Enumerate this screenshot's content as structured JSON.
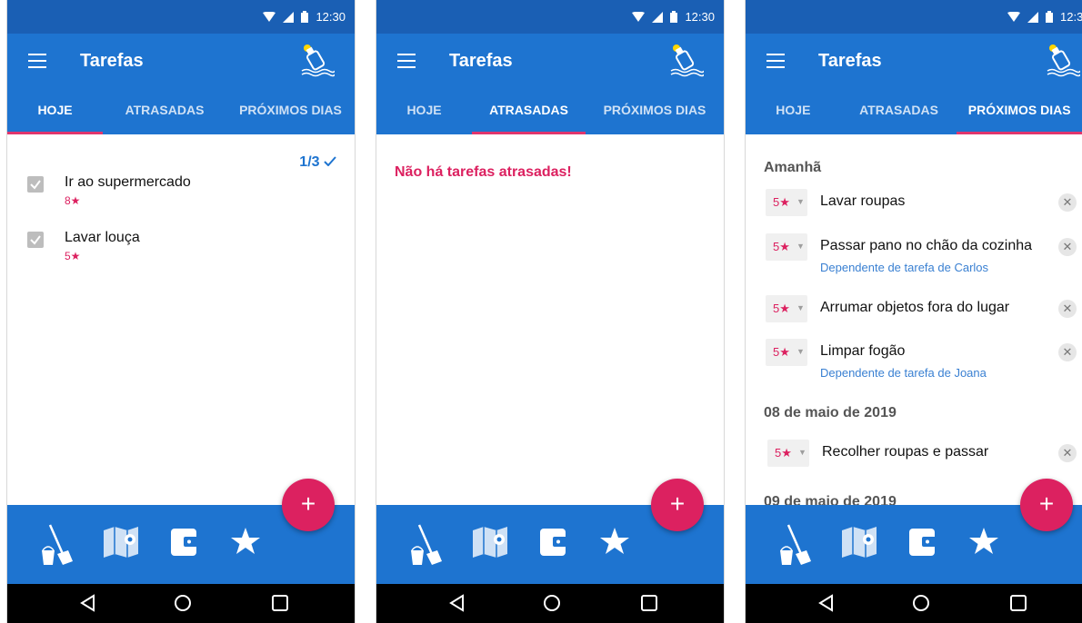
{
  "status": {
    "time": "12:30"
  },
  "app": {
    "title": "Tarefas"
  },
  "tabs": [
    "HOJE",
    "ATRASADAS",
    "PRÓXIMOS DIAS"
  ],
  "today": {
    "counter": "1/3",
    "tasks": [
      {
        "title": "Ir ao supermercado",
        "stars": "8★",
        "checked": true
      },
      {
        "title": "Lavar louça",
        "stars": "5★",
        "checked": true
      }
    ]
  },
  "overdue": {
    "empty_message": "Não há tarefas atrasadas!"
  },
  "upcoming": {
    "sections": [
      {
        "title": "Amanhã",
        "tasks": [
          {
            "stars": "5★",
            "title": "Lavar roupas"
          },
          {
            "stars": "5★",
            "title": "Passar pano no chão da cozinha",
            "dependency": "Dependente de tarefa de Carlos"
          },
          {
            "stars": "5★",
            "title": "Arrumar objetos fora do lugar"
          },
          {
            "stars": "5★",
            "title": "Limpar fogão",
            "dependency": "Dependente de tarefa de Joana"
          }
        ]
      },
      {
        "title": "08 de maio de 2019",
        "tasks": [
          {
            "stars": "5★",
            "title": "Recolher roupas e passar"
          }
        ]
      },
      {
        "title": "09 de maio de 2019",
        "tasks": []
      }
    ]
  },
  "fab": {
    "label": "+"
  },
  "colors": {
    "primary": "#1e74d0",
    "status_bar": "#1a5fb4",
    "accent": "#dc2160",
    "tab_indicator": "#e0356d"
  },
  "bottom_nav": [
    "broom-bucket-icon",
    "map-icon",
    "wallet-icon",
    "star-icon"
  ],
  "system_nav": [
    "back-icon",
    "home-icon",
    "recents-icon"
  ]
}
